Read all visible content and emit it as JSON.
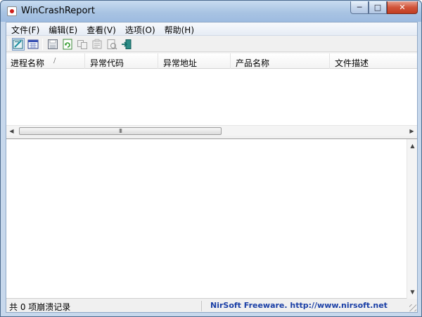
{
  "window": {
    "title": "WinCrashReport",
    "minimize_glyph": "─",
    "maximize_glyph": "□",
    "close_glyph": "✕"
  },
  "menu": [
    "文件(F)",
    "编辑(E)",
    "查看(V)",
    "选项(O)",
    "帮助(H)"
  ],
  "toolbar": {
    "icons": [
      "view-report-icon",
      "calendar-icon",
      "save-icon",
      "refresh-icon",
      "copy-icon",
      "properties-icon",
      "html-report-icon",
      "exit-icon"
    ]
  },
  "list": {
    "columns": [
      "进程名称",
      "异常代码",
      "异常地址",
      "产品名称",
      "文件描述"
    ],
    "sort_indicator": "/",
    "rows": []
  },
  "scrollbar": {
    "thumb_grip": "III",
    "arrow_left": "◀",
    "arrow_right": "▶",
    "arrow_up": "▲",
    "arrow_down": "▼"
  },
  "status": {
    "count_text": "共 0 项崩溃记录",
    "credit_text": "NirSoft Freeware.  http://www.nirsoft.net"
  },
  "colors": {
    "credit": "#1a3fa6",
    "close_button": "#c23e22",
    "titlebar": "#a9c4e3"
  }
}
